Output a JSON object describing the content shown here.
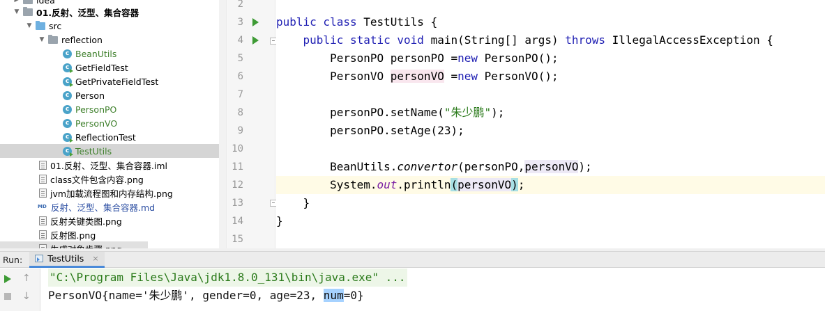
{
  "project_tree": {
    "items": [
      {
        "label": "idea",
        "type": "folder"
      },
      {
        "label": "01.反射、泛型、集合容器",
        "type": "module"
      },
      {
        "label": "src",
        "type": "folder"
      },
      {
        "label": "reflection",
        "type": "package"
      },
      {
        "label": "BeanUtils",
        "type": "class"
      },
      {
        "label": "GetFieldTest",
        "type": "class"
      },
      {
        "label": "GetPrivateFieldTest",
        "type": "class"
      },
      {
        "label": "Person",
        "type": "class"
      },
      {
        "label": "PersonPO",
        "type": "class"
      },
      {
        "label": "PersonVO",
        "type": "class"
      },
      {
        "label": "ReflectionTest",
        "type": "class"
      },
      {
        "label": "TestUtils",
        "type": "class"
      },
      {
        "label": "01.反射、泛型、集合容器.iml",
        "type": "file"
      },
      {
        "label": "class文件包含内容.png",
        "type": "file"
      },
      {
        "label": "jvm加载流程图和内存结构.png",
        "type": "file"
      },
      {
        "label": "反射、泛型、集合容器.md",
        "type": "md"
      },
      {
        "label": "反射关键类图.png",
        "type": "file"
      },
      {
        "label": "反射图.png",
        "type": "file"
      },
      {
        "label": "生成对象步骤.png",
        "type": "file"
      }
    ],
    "md_icon_text": "MD"
  },
  "editor": {
    "line_numbers": [
      "2",
      "3",
      "4",
      "5",
      "6",
      "7",
      "8",
      "9",
      "10",
      "11",
      "12",
      "13",
      "14",
      "15"
    ],
    "code": {
      "l3_kw": "public class ",
      "l3_name": "TestUtils {",
      "l4_kw": "public static void ",
      "l4_method": "main(String[] args) ",
      "l4_throws": "throws ",
      "l4_exc": "IllegalAccessException {",
      "l5_decl": "PersonPO personPO =",
      "l5_new": "new ",
      "l5_ctor": "PersonPO();",
      "l6_type": "PersonVO ",
      "l6_var": "personVO",
      "l6_eq": " =",
      "l6_new": "new ",
      "l6_ctor": "PersonVO();",
      "l8_call": "personPO.setName(",
      "l8_str": "\"朱少鹏\"",
      "l8_end": ");",
      "l9_call": "personPO.setAge(23);",
      "l11_cls": "BeanUtils.",
      "l11_method": "convertor",
      "l11_open": "(personPO,",
      "l11_arg": "personVO",
      "l11_close": ");",
      "l12_cls": "System.",
      "l12_field": "out",
      "l12_call": ".println",
      "l12_open": "(",
      "l12_arg": "personVO",
      "l12_close": ")",
      "l12_semi": ";",
      "l13": "}",
      "l14": "}"
    }
  },
  "run_panel": {
    "label": "Run:",
    "tab_label": "TestUtils",
    "close_glyph": "×",
    "up_glyph": "↑",
    "down_glyph": "↓",
    "command_line": "\"C:\\Program Files\\Java\\jdk1.8.0_131\\bin\\java.exe\" ...",
    "output_before": "PersonVO{name='朱少鹏', gender=0, age=23, ",
    "output_selected": "num",
    "output_after": "=0}"
  }
}
